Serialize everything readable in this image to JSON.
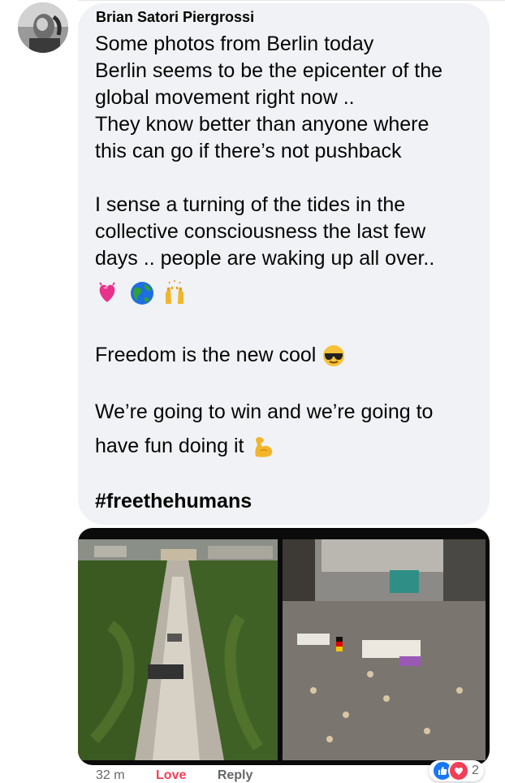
{
  "comment": {
    "author": "Brian Satori Piergrossi",
    "lines": {
      "l1": "Some photos from Berlin today",
      "l2": "Berlin seems to be the epicenter of the",
      "l3": "global movement right now ..",
      "l4": "They know better than anyone where",
      "l5": "this can go if there’s not pushback",
      "l6": "I sense a turning of the tides in the",
      "l7": "collective consciousness the last few",
      "l8": "days .. people are waking up all over..",
      "l9": "Freedom is the new cool",
      "l10": "We’re going to win and we’re going to",
      "l11": "have fun doing it",
      "hashtag": "#freethehumans"
    },
    "emoji_row": [
      "growing-heart-emoji",
      "globe-emoji",
      "raising-hands-emoji"
    ],
    "cool_emoji": "sunglasses-face-emoji",
    "flex_emoji": "flexed-biceps-emoji"
  },
  "attachment": {
    "photos": [
      "berlin-aerial-crowd-photo",
      "berlin-street-crowd-photo"
    ]
  },
  "actions": {
    "time": "32 m",
    "love": "Love",
    "reply": "Reply"
  },
  "reactions": {
    "types": [
      "like",
      "love"
    ],
    "count": "2",
    "colors": {
      "like": "#1877f2",
      "love": "#f33e58"
    }
  }
}
